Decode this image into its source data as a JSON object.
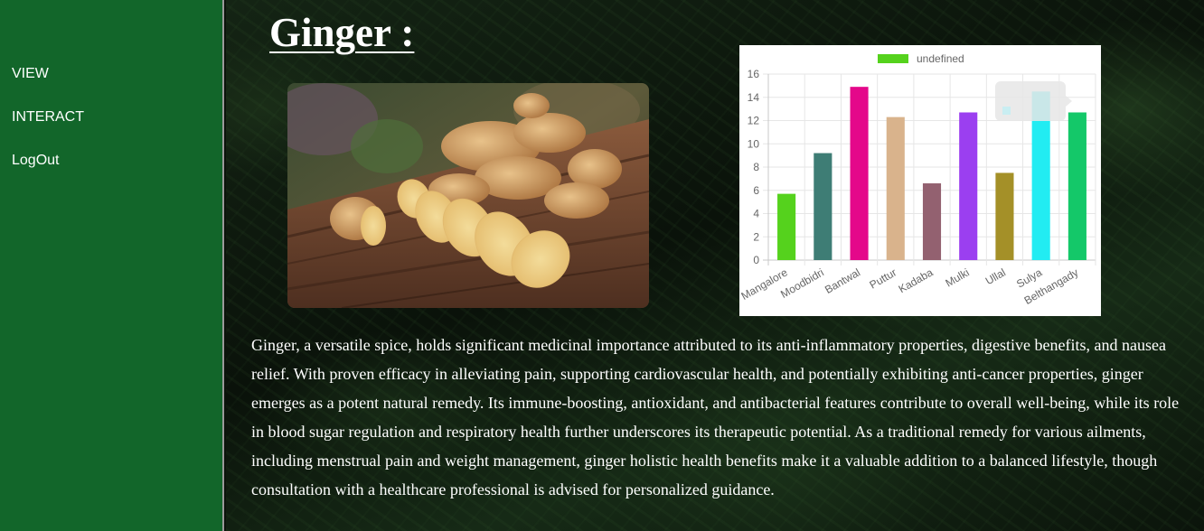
{
  "sidebar": {
    "items": [
      {
        "label": "VIEW"
      },
      {
        "label": "INTERACT"
      },
      {
        "label": "LogOut"
      }
    ]
  },
  "main": {
    "title": "Ginger :",
    "description": "Ginger, a versatile spice, holds significant medicinal importance attributed to its anti-inflammatory properties, digestive benefits, and nausea relief. With proven efficacy in alleviating pain, supporting cardiovascular health, and potentially exhibiting anti-cancer properties, ginger emerges as a potent natural remedy. Its immune-boosting, antioxidant, and antibacterial features contribute to overall well-being, while its role in blood sugar regulation and respiratory health further underscores its therapeutic potential. As a traditional remedy for various ailments, including menstrual pain and weight management, ginger holistic health benefits make it a valuable addition to a balanced lifestyle, though consultation with a healthcare professional is advised for personalized guidance."
  },
  "colors": {
    "sidebar_bg": "#12662a",
    "legend_swatch": "#55d21d"
  },
  "chart_data": {
    "type": "bar",
    "legend": [
      "undefined"
    ],
    "legend_position": "top",
    "grid": true,
    "categories": [
      "Mangalore",
      "Moodbidri",
      "Bantwal",
      "Puttur",
      "Kadaba",
      "Mulki",
      "Ullal",
      "Sulya",
      "Belthangady"
    ],
    "series": [
      {
        "name": "undefined",
        "values": [
          5.7,
          9.2,
          14.9,
          12.3,
          6.6,
          12.7,
          7.5,
          14.5,
          12.7
        ]
      }
    ],
    "bar_colors": [
      "#55d21d",
      "#3e7d75",
      "#e4088a",
      "#d9b38c",
      "#936170",
      "#9b3ff0",
      "#a49028",
      "#22ecf2",
      "#14c869"
    ],
    "ylim": [
      0,
      16
    ],
    "yticks": [
      "0",
      "2",
      "4",
      "6",
      "8",
      "10",
      "12",
      "14",
      "16"
    ]
  }
}
